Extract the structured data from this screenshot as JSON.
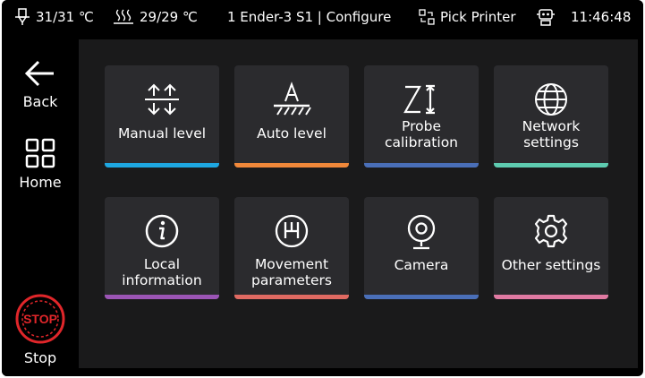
{
  "status_bar": {
    "nozzle_temp": "31/31 ℃",
    "bed_temp": "29/29 ℃",
    "title": "1 Ender-3 S1 | Configure",
    "pick_printer": "Pick Printer",
    "time": "11:46:48"
  },
  "sidebar": {
    "back_label": "Back",
    "home_label": "Home",
    "stop_label": "Stop",
    "stop_badge_text": "STOP"
  },
  "tiles": [
    {
      "label_line1": "Manual level",
      "label_line2": "",
      "accent": "#1ea7e1",
      "icon": "manual-level-arrows-icon"
    },
    {
      "label_line1": "Auto level",
      "label_line2": "",
      "accent": "#f0883a",
      "icon": "auto-level-icon"
    },
    {
      "label_line1": "Probe",
      "label_line2": "calibration",
      "accent": "#4a6fb8",
      "icon": "probe-z-icon"
    },
    {
      "label_line1": "Network",
      "label_line2": "settings",
      "accent": "#5ecbb0",
      "icon": "globe-icon"
    },
    {
      "label_line1": "Local",
      "label_line2": "information",
      "accent": "#9b55b5",
      "icon": "info-icon"
    },
    {
      "label_line1": "Movement",
      "label_line2": "parameters",
      "accent": "#e06a62",
      "icon": "gearshift-icon"
    },
    {
      "label_line1": "Camera",
      "label_line2": "",
      "accent": "#4a6fb8",
      "icon": "camera-icon"
    },
    {
      "label_line1": "Other settings",
      "label_line2": "",
      "accent": "#e07aa2",
      "icon": "gear-icon"
    }
  ],
  "colors": {
    "stop_red": "#e0262a",
    "panel_bg": "#1a1a1b",
    "tile_bg": "#2b2b2e"
  }
}
